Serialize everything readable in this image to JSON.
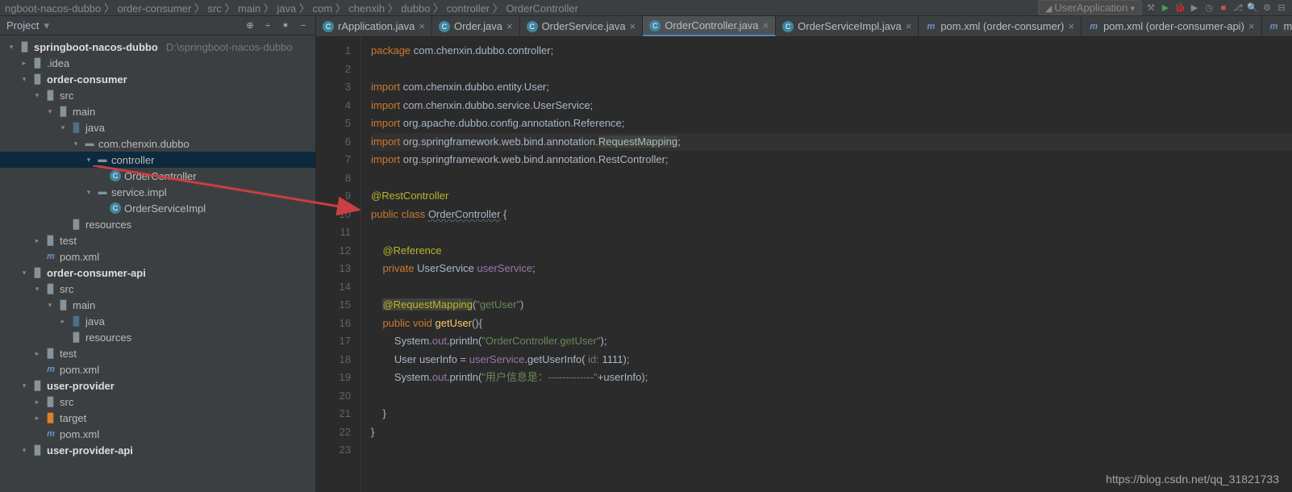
{
  "topbar": {
    "left": "ngboot-nacos-dubbo 〉  order-consumer 〉  src 〉  main 〉  java 〉  com 〉  chenxih 〉  dubbo 〉  controller 〉  OrderController",
    "run": "UserApplication",
    "icons": [
      "hammer",
      "play",
      "debug",
      "stop",
      "search",
      "gear",
      "help",
      "hide"
    ]
  },
  "sidebar": {
    "title": "Project",
    "tree": [
      {
        "d": 0,
        "a": "▾",
        "i": "folder",
        "l": "springboot-nacos-dubbo",
        "p": "D:\\springboot-nacos-dubbo",
        "bold": true
      },
      {
        "d": 1,
        "a": "▸",
        "i": "folder",
        "l": ".idea"
      },
      {
        "d": 1,
        "a": "▾",
        "i": "folder",
        "l": "order-consumer",
        "bold": true
      },
      {
        "d": 2,
        "a": "▾",
        "i": "folder",
        "l": "src"
      },
      {
        "d": 3,
        "a": "▾",
        "i": "folder",
        "l": "main"
      },
      {
        "d": 4,
        "a": "▾",
        "i": "folder",
        "l": "java",
        "c": "#4a708b"
      },
      {
        "d": 5,
        "a": "▾",
        "i": "pkg",
        "l": "com.chenxin.dubbo"
      },
      {
        "d": 6,
        "a": "▾",
        "i": "pkg",
        "l": "controller",
        "sel": true
      },
      {
        "d": 7,
        "a": "",
        "i": "class",
        "l": "OrderController"
      },
      {
        "d": 6,
        "a": "▾",
        "i": "pkg",
        "l": "service.impl"
      },
      {
        "d": 7,
        "a": "",
        "i": "class",
        "l": "OrderServiceImpl"
      },
      {
        "d": 4,
        "a": "",
        "i": "folder",
        "l": "resources"
      },
      {
        "d": 2,
        "a": "▸",
        "i": "folder",
        "l": "test"
      },
      {
        "d": 2,
        "a": "",
        "i": "m",
        "l": "pom.xml"
      },
      {
        "d": 1,
        "a": "▾",
        "i": "folder",
        "l": "order-consumer-api",
        "bold": true
      },
      {
        "d": 2,
        "a": "▾",
        "i": "folder",
        "l": "src"
      },
      {
        "d": 3,
        "a": "▾",
        "i": "folder",
        "l": "main"
      },
      {
        "d": 4,
        "a": "▸",
        "i": "folder",
        "l": "java",
        "c": "#4a708b"
      },
      {
        "d": 4,
        "a": "",
        "i": "folder",
        "l": "resources"
      },
      {
        "d": 2,
        "a": "▸",
        "i": "folder",
        "l": "test"
      },
      {
        "d": 2,
        "a": "",
        "i": "m",
        "l": "pom.xml"
      },
      {
        "d": 1,
        "a": "▾",
        "i": "folder",
        "l": "user-provider",
        "bold": true
      },
      {
        "d": 2,
        "a": "▸",
        "i": "folder",
        "l": "src"
      },
      {
        "d": 2,
        "a": "▸",
        "i": "target",
        "l": "target"
      },
      {
        "d": 2,
        "a": "",
        "i": "m",
        "l": "pom.xml"
      },
      {
        "d": 1,
        "a": "▾",
        "i": "folder",
        "l": "user-provider-api",
        "bold": true
      }
    ]
  },
  "tabs": [
    {
      "l": "rApplication.java",
      "i": "class"
    },
    {
      "l": "Order.java",
      "i": "class"
    },
    {
      "l": "OrderService.java",
      "i": "class"
    },
    {
      "l": "OrderController.java",
      "i": "class",
      "active": true
    },
    {
      "l": "OrderServiceImpl.java",
      "i": "class"
    },
    {
      "l": "pom.xml (order-consumer)",
      "i": "m"
    },
    {
      "l": "pom.xml (order-consumer-api)",
      "i": "m"
    },
    {
      "l": "m",
      "i": "m",
      "cut": true
    }
  ],
  "code": {
    "start": 1,
    "lines": [
      [
        {
          "t": "package ",
          "c": "kw"
        },
        {
          "t": "com.chenxin.dubbo.controller;"
        }
      ],
      [],
      [
        {
          "t": "import ",
          "c": "kw"
        },
        {
          "t": "com.chenxin.dubbo.entity.User;"
        }
      ],
      [
        {
          "t": "import ",
          "c": "kw"
        },
        {
          "t": "com.chenxin.dubbo.service.UserService;"
        }
      ],
      [
        {
          "t": "import ",
          "c": "kw"
        },
        {
          "t": "org.apache.dubbo.config.annotation.Reference;"
        }
      ],
      [
        {
          "t": "import ",
          "c": "kw"
        },
        {
          "t": "org.springframework.web.bind.annotation."
        },
        {
          "t": "RequestMapping",
          "c": "hl-y"
        },
        {
          "t": ";"
        }
      ],
      [
        {
          "t": "import ",
          "c": "kw"
        },
        {
          "t": "org.springframework.web.bind.annotation.RestController;"
        }
      ],
      [],
      [
        {
          "t": "@RestController",
          "c": "ann"
        }
      ],
      [
        {
          "t": "public class ",
          "c": "kw"
        },
        {
          "t": "OrderController",
          "c": "underline"
        },
        {
          "t": " {"
        }
      ],
      [],
      [
        {
          "t": "    "
        },
        {
          "t": "@Reference",
          "c": "ann"
        }
      ],
      [
        {
          "t": "    "
        },
        {
          "t": "private ",
          "c": "kw"
        },
        {
          "t": "UserService "
        },
        {
          "t": "userService",
          "c": "fld"
        },
        {
          "t": ";"
        }
      ],
      [],
      [
        {
          "t": "    "
        },
        {
          "t": "@RequestMapping",
          "c": "ann hl-y"
        },
        {
          "t": "("
        },
        {
          "t": "\"getUser\"",
          "c": "str"
        },
        {
          "t": ")"
        }
      ],
      [
        {
          "t": "    "
        },
        {
          "t": "public void ",
          "c": "kw"
        },
        {
          "t": "getUser",
          "c": "mtd"
        },
        {
          "t": "(){"
        }
      ],
      [
        {
          "t": "        System."
        },
        {
          "t": "out",
          "c": "fld"
        },
        {
          "t": ".println("
        },
        {
          "t": "\"OrderController.getUser\"",
          "c": "str"
        },
        {
          "t": ");"
        }
      ],
      [
        {
          "t": "        User userInfo = "
        },
        {
          "t": "userService",
          "c": "fld"
        },
        {
          "t": ".getUserInfo( "
        },
        {
          "t": "id: ",
          "c": "param"
        },
        {
          "t": "1111);"
        }
      ],
      [
        {
          "t": "        System."
        },
        {
          "t": "out",
          "c": "fld"
        },
        {
          "t": ".println("
        },
        {
          "t": "\"用户信息是：-------------\"",
          "c": "str"
        },
        {
          "t": "+userInfo);"
        }
      ],
      [],
      [
        {
          "t": "    }"
        }
      ],
      [
        {
          "t": "}"
        }
      ],
      []
    ],
    "hl": 6
  },
  "watermark": "https://blog.csdn.net/qq_31821733"
}
